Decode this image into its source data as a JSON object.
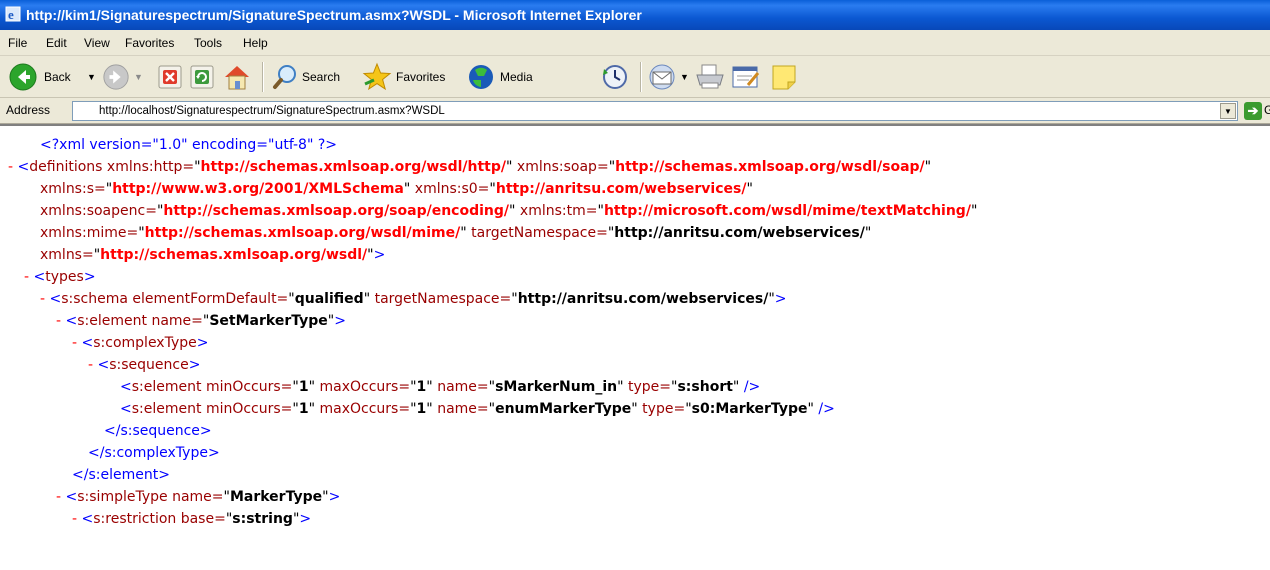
{
  "window": {
    "title": "http://kim1/Signaturespectrum/SignatureSpectrum.asmx?WSDL - Microsoft Internet Explorer"
  },
  "menu": [
    "File",
    "Edit",
    "View",
    "Favorites",
    "Tools",
    "Help"
  ],
  "toolbar": {
    "back_label": "Back",
    "search_label": "Search",
    "favorites_label": "Favorites",
    "media_label": "Media"
  },
  "address": {
    "label": "Address",
    "value": "http://localhost/Signaturespectrum/SignatureSpectrum.asmx?WSDL",
    "go_label": "G"
  },
  "xml": {
    "pi": "<?xml version=\"1.0\" encoding=\"utf-8\" ?>",
    "defs_open": "<definitions",
    "xmlns_http_attr": "xmlns:http=",
    "xmlns_http_val": "http://schemas.xmlsoap.org/wsdl/http/",
    "xmlns_soap_attr": "xmlns:soap=",
    "xmlns_soap_val": "http://schemas.xmlsoap.org/wsdl/soap/",
    "xmlns_s_attr": "xmlns:s=",
    "xmlns_s_val": "http://www.w3.org/2001/XMLSchema",
    "xmlns_s0_attr": "xmlns:s0=",
    "xmlns_s0_val": "http://anritsu.com/webservices/",
    "xmlns_soapenc_attr": "xmlns:soapenc=",
    "xmlns_soapenc_val": "http://schemas.xmlsoap.org/soap/encoding/",
    "xmlns_tm_attr": "xmlns:tm=",
    "xmlns_tm_val": "http://microsoft.com/wsdl/mime/textMatching/",
    "xmlns_mime_attr": "xmlns:mime=",
    "xmlns_mime_val": "http://schemas.xmlsoap.org/wsdl/mime/",
    "tns_attr": "targetNamespace=",
    "tns_val": "http://anritsu.com/webservices/",
    "xmlns_attr": "xmlns=",
    "xmlns_val": "http://schemas.xmlsoap.org/wsdl/",
    "types_open": "<types>",
    "schema_open": "<s:schema",
    "efd_attr": "elementFormDefault=",
    "efd_val": "qualified",
    "schema_tns_attr": "targetNamespace=",
    "schema_tns_val": "http://anritsu.com/webservices/",
    "element_open": "<s:element",
    "name_attr": "name=",
    "elem1_name": "SetMarkerType",
    "complex_open": "<s:complexType>",
    "sequence_open": "<s:sequence>",
    "minoccurs_attr": "minOccurs=",
    "maxoccurs_attr": "maxOccurs=",
    "type_attr": "type=",
    "one": "1",
    "child1_name": "sMarkerNum_in",
    "child1_type": "s:short",
    "child2_name": "enumMarkerType",
    "child2_type": "s0:MarkerType",
    "sequence_close": "</s:sequence>",
    "complex_close": "</s:complexType>",
    "element_close": "</s:element>",
    "simple_open": "<s:simpleType",
    "simple_name": "MarkerType",
    "restriction_open": "<s:restriction",
    "base_attr": "base=",
    "restriction_base": "s:string"
  }
}
